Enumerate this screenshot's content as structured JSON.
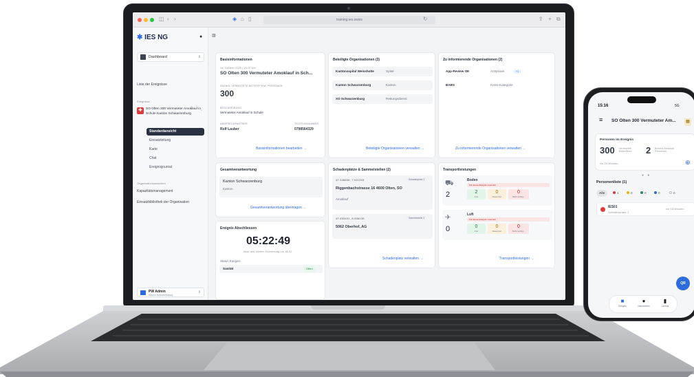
{
  "browser": {
    "url": "training.ies.swiss"
  },
  "sidebar": {
    "logo": "IES NG",
    "dashboard": "Dashboard",
    "list_events": "Liste der Ereignisse",
    "events_section": "Ereignisse",
    "event_name": "SO Olten 300 Vermuteter Amoklauf in Schule Kanton Schwarzenburg",
    "subnav": [
      "Standardansicht",
      "Einsatzleitung",
      "Karte",
      "Chat",
      "Ereignisjournal"
    ],
    "org_section": "Organisationsansichten",
    "org_items": [
      "Kapazitätsmanagement",
      "Einsatzbibliothek der Organisation"
    ],
    "user": {
      "name": "PW Admin",
      "role": "Kanton Schwarzenburg"
    }
  },
  "basis": {
    "title": "Basisinformationen",
    "date": "16. Oktober 2025 | 18:22 Uhr",
    "event": "SO Olten 300 Vermuteter Amoklauf in Sch...",
    "persons_label": "ANZAHL VERMUTETE BETROFFENE PERSONEN",
    "persons": "300",
    "desc_label": "BESCHREIBUNG",
    "desc": "Vermuteter Amoklauf in Schule",
    "contact_label": "ANSPRECHPARTNER",
    "phone_label": "TELEFONNUMMER",
    "contact": "Rolf Lauber",
    "phone": "0798564329",
    "link": "Basisinformationen bearbeiten"
  },
  "beteiligte": {
    "title": "Beteiligte Organisationen (3)",
    "rows": [
      {
        "org": "Kantonsspital Weissholte",
        "type": "Spital"
      },
      {
        "org": "Kanton Schwarzenburg",
        "type": "Kanton"
      },
      {
        "org": "XO Schwarzenburg",
        "type": "Rettungsdienst"
      }
    ],
    "link": "Beteiligte Organisationen verwalten"
  },
  "informierende": {
    "title": "Zu informierende Organisationen (2)",
    "rows": [
      {
        "org": "App-Review OE",
        "type": "Arztpraxis",
        "chip": "+1"
      },
      {
        "org": "BABS",
        "type": "Keine Kategorie",
        "chip": ""
      }
    ],
    "link": "Zu informierende Organisationen verwalten"
  },
  "gesamt": {
    "title": "Gesamtverantwortung",
    "org": "Kanton Schwarzenburg",
    "type": "Kanton",
    "link": "Gesamtverantwortung übertragen"
  },
  "abschluss": {
    "title": "Ereignis Abschliessen",
    "timer": "05:22:49",
    "sub": "Aktiv seit letztem Donnerstag um 18:22",
    "status_label": "Status Ereignis",
    "sanitaet": "Sanität",
    "status": "Offen"
  },
  "schaden": {
    "title": "Schadenplätze & Sammelstellen (2)",
    "items": [
      {
        "coords": "47.346836, 7.911263",
        "tag": "Schadenplatz 1",
        "name": "Riggenbachstrasse 16 4600 Olten, SO",
        "type": "Amoklauf"
      },
      {
        "coords": "47.453491, 8.008135",
        "tag": "Sammelstelle 1",
        "name": "5062 Oberhof, AG",
        "type": ""
      }
    ],
    "link": "Schadenplatz verwalten"
  },
  "transport": {
    "title": "Transportleistungen",
    "boden": {
      "label": "Boden",
      "total": "2",
      "warn": "Für dieses Ereignis reserviert",
      "frei": "2",
      "reserviert": "0",
      "nicht": "0"
    },
    "luft": {
      "label": "Luft",
      "total": "0",
      "warn": "Für dieses Ereignis reserviert",
      "frei": "0",
      "reserviert": "0",
      "nicht": "0"
    },
    "frei_label": "Frei",
    "res_label": "Reserviert",
    "nicht_label": "Nicht verfüg...",
    "link": "Transportleistungen"
  },
  "phone": {
    "time": "15:16",
    "signal": "5G",
    "title": "SO Olten 300 Vermuteter Am...",
    "card_title": "Personen im Ereignis",
    "vermutete": "300",
    "vermutete_label": "Vermutete Betroffene",
    "erfasste": "2",
    "erfasste_label": "Bereits erfasste Personen",
    "updated": "vor 20 Minuten",
    "list_title": "Personenliste (1)",
    "filters": [
      "Alle",
      "1",
      "0",
      "0",
      "0",
      "0"
    ],
    "item_id": "IES01",
    "item_sub": "Schadenplatz 1",
    "item_time": "vor 18 Minuten",
    "fab": "QR",
    "tabs": [
      "Ereignis",
      "Nachrichten",
      "Journal"
    ]
  },
  "colors": {
    "accent": "#2d6cdf",
    "danger": "#e03a3a",
    "success": "#2e8b57"
  }
}
